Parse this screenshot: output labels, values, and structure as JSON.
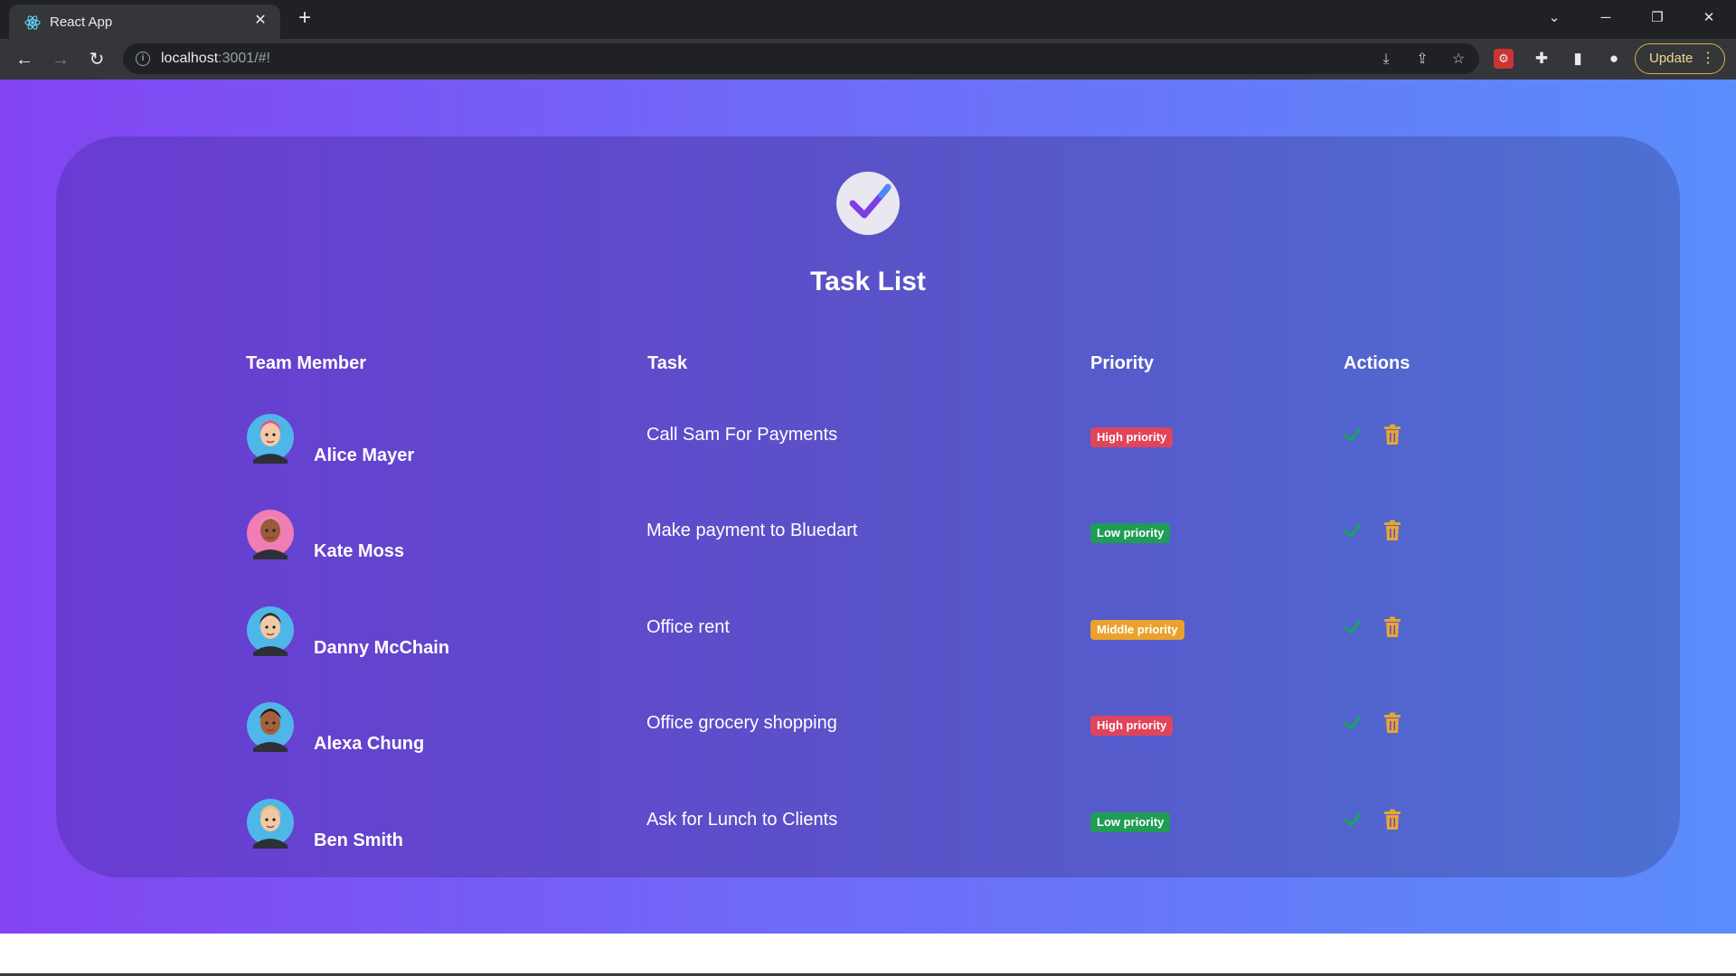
{
  "browser": {
    "tab_title": "React App",
    "url_host": "localhost",
    "url_rest": ":3001/#!",
    "update_label": "Update"
  },
  "app": {
    "title": "Task List",
    "columns": {
      "member": "Team Member",
      "task": "Task",
      "priority": "Priority",
      "actions": "Actions"
    },
    "rows": [
      {
        "member": "Alice Mayer",
        "task": "Call Sam For Payments",
        "priority": "High priority",
        "priority_color": "#e0445a",
        "avatar_bg": "#4fb6e8",
        "avatar_skin": "#f3c8a4",
        "avatar_hair": "#e94f8a"
      },
      {
        "member": "Kate Moss",
        "task": "Make payment to Bluedart",
        "priority": "Low priority",
        "priority_color": "#1f9d55",
        "avatar_bg": "#f07db3",
        "avatar_skin": "#9b5a3c",
        "avatar_hair": "#f48cc0"
      },
      {
        "member": "Danny McChain",
        "task": "Office rent",
        "priority": "Middle priority",
        "priority_color": "#eaa22c",
        "avatar_bg": "#4fb6e8",
        "avatar_skin": "#f3c8a4",
        "avatar_hair": "#2c2c2c"
      },
      {
        "member": "Alexa Chung",
        "task": "Office grocery shopping",
        "priority": "High priority",
        "priority_color": "#e0445a",
        "avatar_bg": "#4fb6e8",
        "avatar_skin": "#a5603a",
        "avatar_hair": "#2b1a12"
      },
      {
        "member": "Ben Smith",
        "task": "Ask for Lunch to Clients",
        "priority": "Low priority",
        "priority_color": "#1f9d55",
        "avatar_bg": "#4fb6e8",
        "avatar_skin": "#f3c8a4",
        "avatar_hair": "#e2c27a"
      }
    ],
    "colors": {
      "check": "#1aa45c",
      "trash": "#e8a530"
    }
  }
}
